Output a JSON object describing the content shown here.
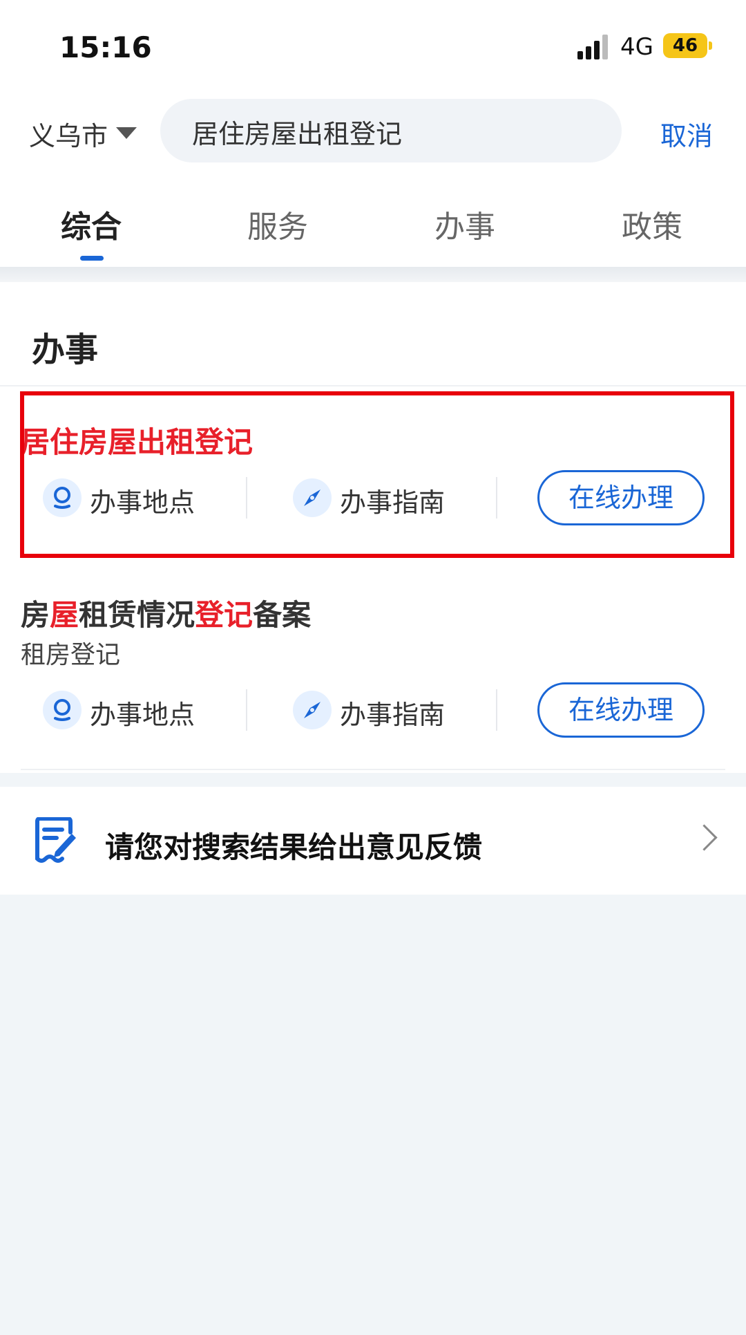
{
  "status_bar": {
    "time": "15:16",
    "network": "4G",
    "battery": "46"
  },
  "header": {
    "city": "义乌市",
    "search_value": "居住房屋出租登记",
    "cancel_label": "取消"
  },
  "tabs": [
    {
      "label": "综合",
      "active": true
    },
    {
      "label": "服务",
      "active": false
    },
    {
      "label": "办事",
      "active": false
    },
    {
      "label": "政策",
      "active": false
    }
  ],
  "section": {
    "title": "办事"
  },
  "results": [
    {
      "title_segments": [
        {
          "text": "居住房屋出租登记",
          "highlight": true
        }
      ],
      "location_label": "办事地点",
      "guide_label": "办事指南",
      "online_label": "在线办理"
    },
    {
      "title_segments": [
        {
          "text": "房",
          "highlight": false
        },
        {
          "text": "屋",
          "highlight": true
        },
        {
          "text": "租赁情况",
          "highlight": false
        },
        {
          "text": "登记",
          "highlight": true
        },
        {
          "text": "备案",
          "highlight": false
        }
      ],
      "subtitle": "租房登记",
      "location_label": "办事地点",
      "guide_label": "办事指南",
      "online_label": "在线办理"
    }
  ],
  "feedback": {
    "label": "请您对搜索结果给出意见反馈"
  },
  "colors": {
    "accent": "#1a66d6",
    "highlight_red": "#e8202a",
    "annotation_red": "#e8000b"
  }
}
